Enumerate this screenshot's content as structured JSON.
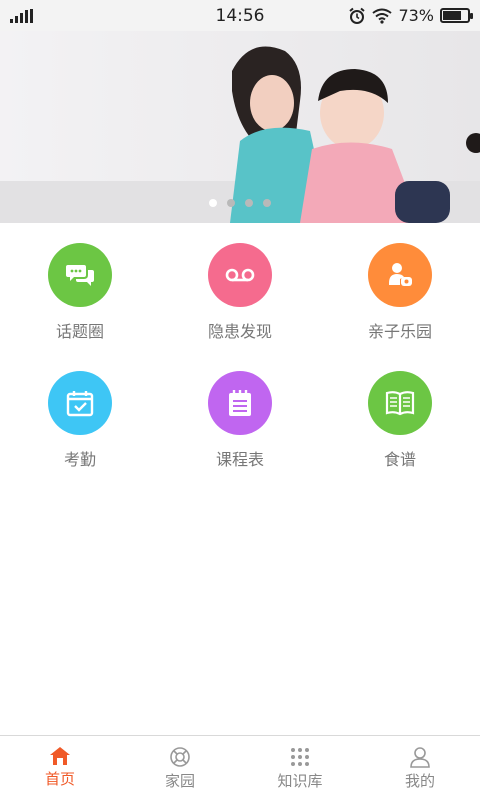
{
  "status_bar": {
    "time": "14:56",
    "battery_percent": "73%",
    "battery_level": 0.73,
    "icons": [
      "signal-icon",
      "alarm-icon",
      "wifi-icon",
      "battery-icon"
    ]
  },
  "banner": {
    "slide_count": 4,
    "active_index": 0
  },
  "menu": [
    {
      "label": "话题圈",
      "icon": "chat-bubbles-icon",
      "color": "#6cc644"
    },
    {
      "label": "隐患发现",
      "icon": "voicemail-icon",
      "color": "#f56b8e"
    },
    {
      "label": "亲子乐园",
      "icon": "parent-child-icon",
      "color": "#ff8c3a"
    },
    {
      "label": "考勤",
      "icon": "calendar-check-icon",
      "color": "#3ec6f5"
    },
    {
      "label": "课程表",
      "icon": "schedule-list-icon",
      "color": "#c066f0"
    },
    {
      "label": "食谱",
      "icon": "recipe-book-icon",
      "color": "#6cc644"
    }
  ],
  "bottom_nav": [
    {
      "label": "首页",
      "icon": "home-icon",
      "active": true
    },
    {
      "label": "家园",
      "icon": "lifebuoy-icon",
      "active": false
    },
    {
      "label": "知识库",
      "icon": "grid-dots-icon",
      "active": false
    },
    {
      "label": "我的",
      "icon": "user-icon",
      "active": false
    }
  ],
  "colors": {
    "accent": "#f05a28",
    "nav_inactive": "#888888",
    "label_gray": "#777777"
  }
}
